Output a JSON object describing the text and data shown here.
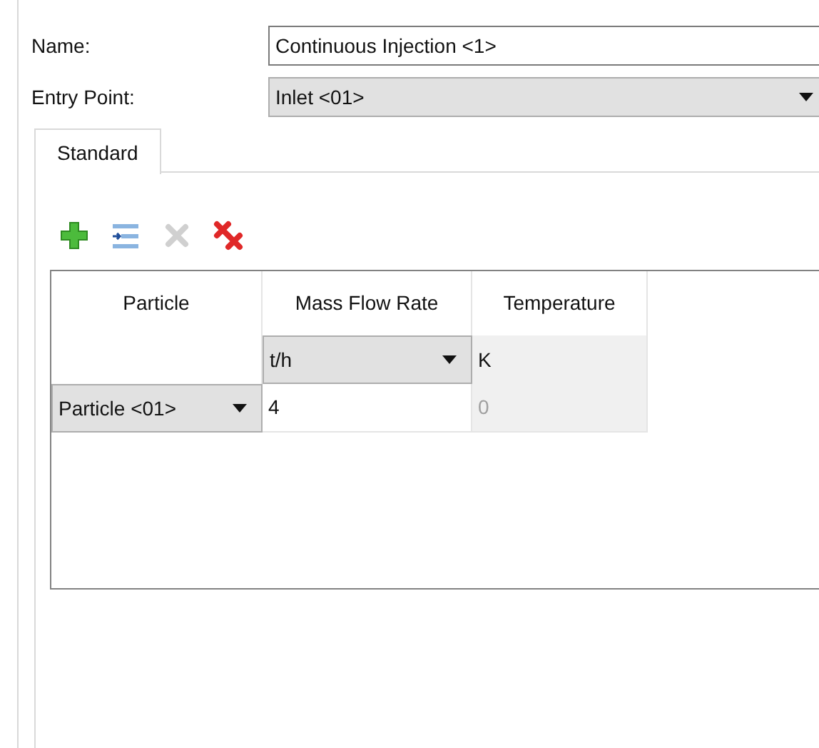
{
  "fields": [
    {
      "label": "Name:",
      "kind": "text",
      "value": "Continuous Injection <1>"
    },
    {
      "label": "Entry Point:",
      "kind": "combo",
      "value": "Inlet <01>"
    }
  ],
  "tabs": [
    {
      "label": "Standard",
      "selected": true
    }
  ],
  "toolbar": [
    {
      "kind": "add",
      "disabled": false
    },
    {
      "kind": "insert",
      "disabled": false
    },
    {
      "kind": "delete",
      "disabled": true
    },
    {
      "kind": "delete-all",
      "disabled": false
    }
  ],
  "table": {
    "columns": [
      {
        "header": "Particle"
      },
      {
        "header": "Mass Flow Rate",
        "unit": {
          "kind": "combo",
          "value": "t/h"
        }
      },
      {
        "header": "Temperature",
        "unit": {
          "kind": "text",
          "value": "K"
        }
      }
    ],
    "rows": [
      [
        {
          "kind": "combo",
          "value": "Particle <01>",
          "disabled": false
        },
        {
          "kind": "text",
          "value": "4",
          "disabled": false
        },
        {
          "kind": "text",
          "value": "0",
          "disabled": true
        }
      ]
    ]
  }
}
